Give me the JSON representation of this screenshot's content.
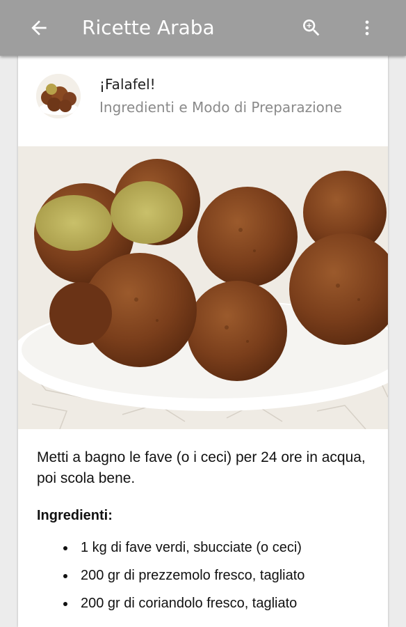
{
  "appbar": {
    "title": "Ricette Araba",
    "back_icon": "arrow-back-icon",
    "search_icon": "search-icon",
    "more_icon": "more-vert-icon",
    "color": "#9e9e9e"
  },
  "post": {
    "title": "¡Falafel!",
    "subtitle": "Ingredienti e Modo di Preparazione",
    "avatar": "falafel-thumbnail",
    "photo": "falafel-photo"
  },
  "content": {
    "intro": "Metti a bagno le fave (o i ceci) per 24  ore in acqua, poi scola bene.",
    "ingredients_heading": "Ingredienti:",
    "ingredients": [
      "1 kg di fave verdi, sbucciate (o ceci)",
      "200 gr di prezzemolo fresco, tagliato",
      "200 gr di coriandolo fresco, tagliato"
    ]
  }
}
